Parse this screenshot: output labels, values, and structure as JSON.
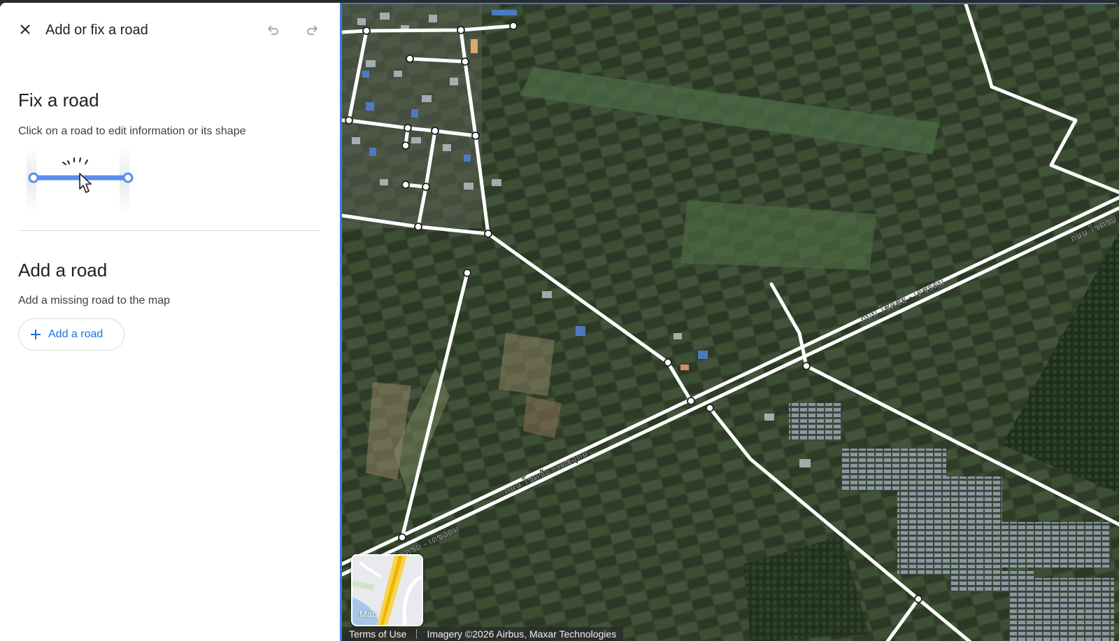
{
  "panel": {
    "title": "Add or fix a road",
    "icons": {
      "close": "close-icon",
      "undo": "undo-icon",
      "redo": "redo-icon"
    },
    "fix": {
      "heading": "Fix a road",
      "description": "Click on a road to edit information or its shape"
    },
    "add": {
      "heading": "Add a road",
      "description": "Add a missing road to the map",
      "button_label": "Add a road"
    }
  },
  "map": {
    "road_labels": [
      "ถนน โชคชัย - เดชอุดม",
      "ถนน โชคชัย - เดชอุดม",
      "ถนน โชคชัย - เดชอุดม",
      "โชคชัย - เดชอุดม"
    ],
    "map_type_label": "Map",
    "terms_label": "Terms of Use",
    "imagery_credit": "Imagery ©2026 Airbus, Maxar Technologies"
  },
  "colors": {
    "accent": "#1a73e8",
    "map_border": "#3b78e7",
    "satellite_base": "#3a4a32"
  }
}
